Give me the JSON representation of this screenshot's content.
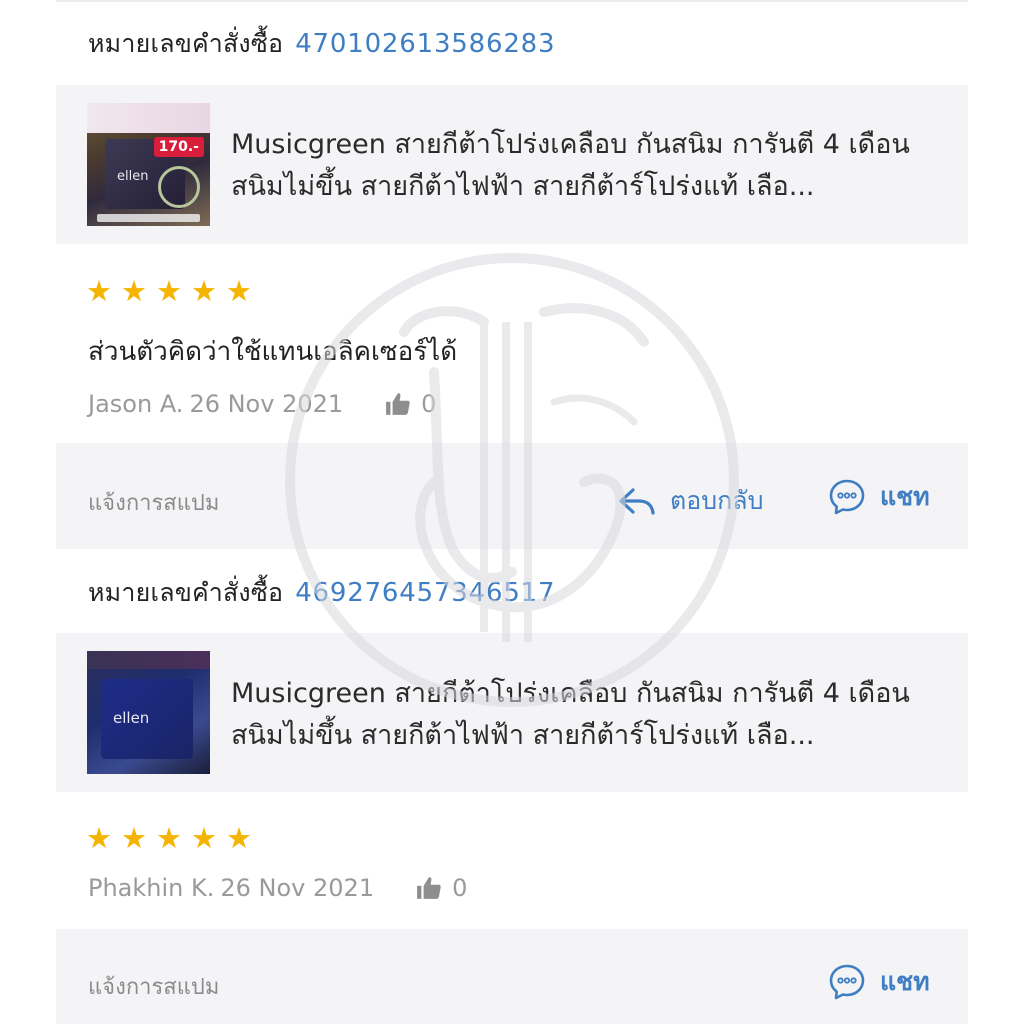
{
  "reviews": [
    {
      "order_label": "หมายเลขคำสั่งซื้อ",
      "order_number": "470102613586283",
      "product_title": "Musicgreen สายกีต้าโปร่งเคลือบ กันสนิม การันตี 4 เดือนสนิมไม่ขึ้น สายกีต้าไฟฟ้า สายกีต้าร์โปร่งแท้ เลือ...",
      "thumbnail_brand": "ellen",
      "thumbnail_price": "170.-",
      "rating": 5,
      "comment": "ส่วนตัวคิดว่าใช้แทนเอลิคเซอร์ได้",
      "author": "Jason A.",
      "date": "26 Nov 2021",
      "likes": "0",
      "report_label": "แจ้งการสแปม",
      "reply_label": "ตอบกลับ",
      "chat_label": "แชท"
    },
    {
      "order_label": "หมายเลขคำสั่งซื้อ",
      "order_number": "469276457346517",
      "product_title": "Musicgreen สายกีต้าโปร่งเคลือบ กันสนิม การันตี 4 เดือนสนิมไม่ขึ้น สายกีต้าไฟฟ้า สายกีต้าร์โปร่งแท้ เลือ...",
      "thumbnail_brand": "ellen",
      "rating": 5,
      "author": "Phakhin K.",
      "date": "26 Nov 2021",
      "likes": "0",
      "report_label": "แจ้งการสแปม",
      "chat_label": "แชท"
    }
  ],
  "colors": {
    "accent": "#3f7ec3",
    "star": "#f5b400",
    "panel": "#f4f4f7",
    "muted": "#9a9a9a"
  },
  "icons": [
    "star-icon",
    "thumbs-up-icon",
    "reply-arrow-icon",
    "chat-bubble-icon",
    "watermark-logo"
  ]
}
